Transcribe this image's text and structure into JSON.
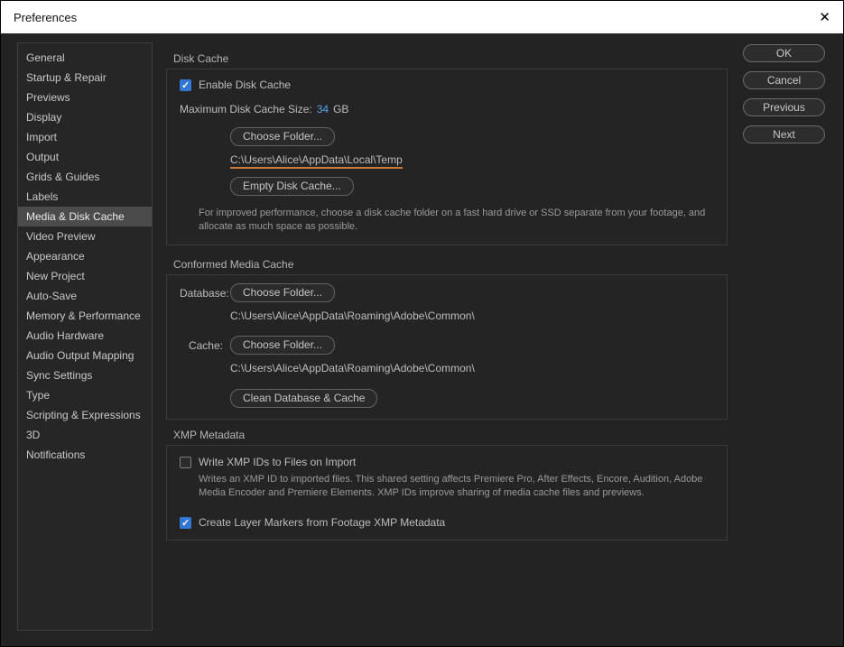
{
  "window": {
    "title": "Preferences",
    "close_glyph": "✕"
  },
  "sidebar": {
    "items": [
      {
        "label": "General",
        "selected": false
      },
      {
        "label": "Startup & Repair",
        "selected": false
      },
      {
        "label": "Previews",
        "selected": false
      },
      {
        "label": "Display",
        "selected": false
      },
      {
        "label": "Import",
        "selected": false
      },
      {
        "label": "Output",
        "selected": false
      },
      {
        "label": "Grids & Guides",
        "selected": false
      },
      {
        "label": "Labels",
        "selected": false
      },
      {
        "label": "Media & Disk Cache",
        "selected": true
      },
      {
        "label": "Video Preview",
        "selected": false
      },
      {
        "label": "Appearance",
        "selected": false
      },
      {
        "label": "New Project",
        "selected": false
      },
      {
        "label": "Auto-Save",
        "selected": false
      },
      {
        "label": "Memory & Performance",
        "selected": false
      },
      {
        "label": "Audio Hardware",
        "selected": false
      },
      {
        "label": "Audio Output Mapping",
        "selected": false
      },
      {
        "label": "Sync Settings",
        "selected": false
      },
      {
        "label": "Type",
        "selected": false
      },
      {
        "label": "Scripting & Expressions",
        "selected": false
      },
      {
        "label": "3D",
        "selected": false
      },
      {
        "label": "Notifications",
        "selected": false
      }
    ]
  },
  "actions": {
    "ok": "OK",
    "cancel": "Cancel",
    "previous": "Previous",
    "next": "Next"
  },
  "disk_cache": {
    "section_title": "Disk Cache",
    "enable_label": "Enable Disk Cache",
    "enable_checked": true,
    "max_size_label": "Maximum Disk Cache Size:",
    "max_size_value": "34",
    "max_size_unit": "GB",
    "choose_folder_button": "Choose Folder...",
    "folder_path": "C:\\Users\\Alice\\AppData\\Local\\Temp",
    "empty_button": "Empty Disk Cache...",
    "help_text": "For improved performance, choose a disk cache folder on a fast hard drive or SSD separate from your footage, and allocate as much space as possible.",
    "accent_underline_color": "#cb7a3c"
  },
  "conformed_media_cache": {
    "section_title": "Conformed Media Cache",
    "database_label": "Database:",
    "database_choose_button": "Choose Folder...",
    "database_path": "C:\\Users\\Alice\\AppData\\Roaming\\Adobe\\Common\\",
    "cache_label": "Cache:",
    "cache_choose_button": "Choose Folder...",
    "cache_path": "C:\\Users\\Alice\\AppData\\Roaming\\Adobe\\Common\\",
    "clean_button": "Clean Database & Cache"
  },
  "xmp_metadata": {
    "section_title": "XMP Metadata",
    "write_label": "Write XMP IDs to Files on Import",
    "write_checked": false,
    "write_help": "Writes an XMP ID to imported files. This shared setting affects Premiere Pro, After Effects, Encore, Audition, Adobe Media Encoder and Premiere Elements. XMP IDs improve sharing of media cache files and previews.",
    "markers_label": "Create Layer Markers from Footage XMP Metadata",
    "markers_checked": true
  },
  "colors": {
    "checkbox_checked": "#3277d5",
    "value_blue": "#55a3ea",
    "path_underline_orange": "#cb7a3c"
  }
}
